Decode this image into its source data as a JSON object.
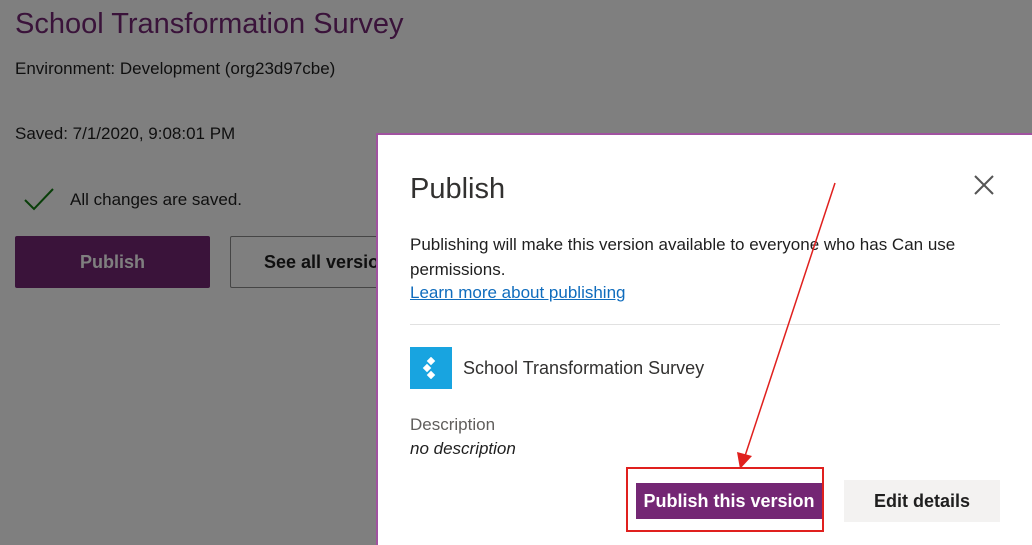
{
  "page": {
    "title": "School Transformation Survey",
    "environment": "Environment: Development (org23d97cbe)",
    "saved": "Saved: 7/1/2020, 9:08:01 PM",
    "status_text": "All changes are saved.",
    "publish_label": "Publish",
    "see_versions_label": "See all versions"
  },
  "dialog": {
    "title": "Publish",
    "body": "Publishing will make this version available to everyone who has Can use permissions.",
    "link": "Learn more about publishing",
    "app_name": "School Transformation Survey",
    "description_label": "Description",
    "description_value": "no description",
    "publish_version_label": "Publish this version",
    "edit_details_label": "Edit details"
  },
  "colors": {
    "accent": "#742774",
    "link": "#0f6cbd",
    "app_icon": "#18a4e0",
    "annotation": "#e0201e",
    "success": "#107c10"
  },
  "icons": [
    "checkmark-icon",
    "close-icon",
    "app-logo-icon"
  ]
}
